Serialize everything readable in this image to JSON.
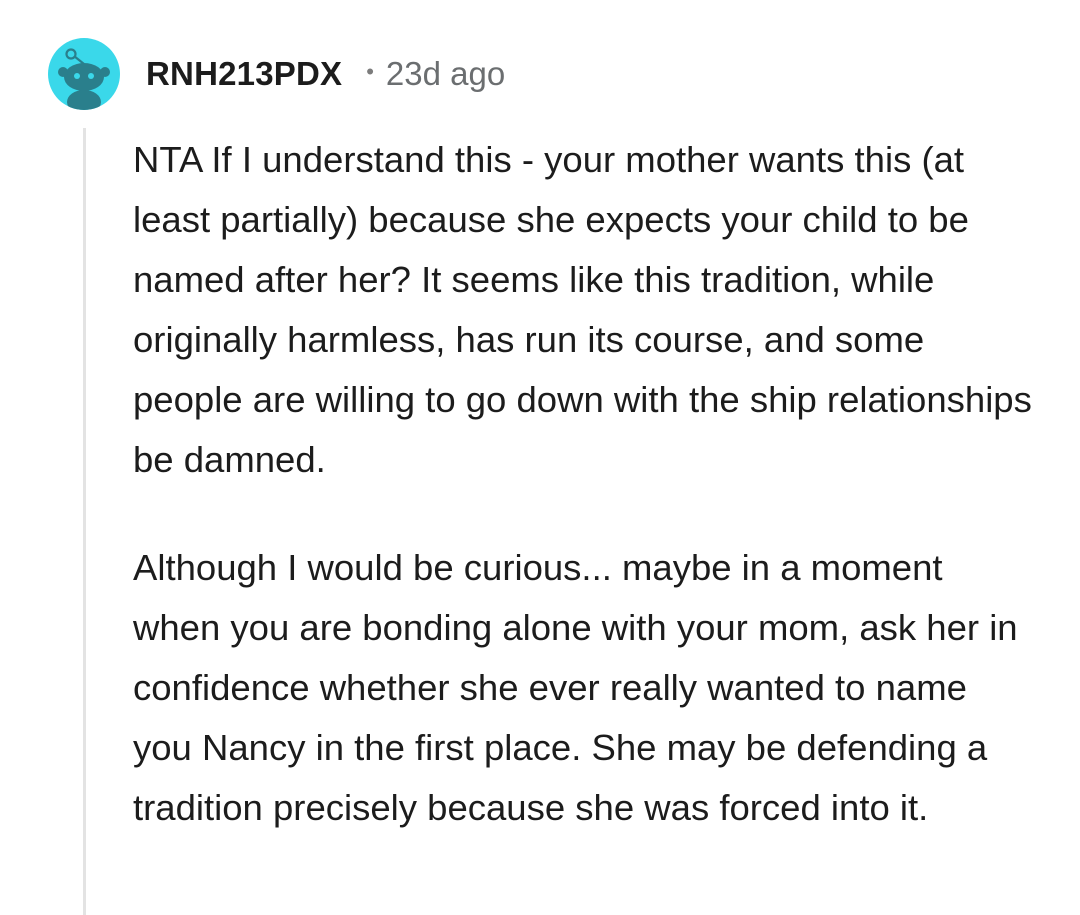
{
  "comment": {
    "author": "RNH213PDX",
    "separator": "•",
    "time": "23d ago",
    "avatar_icon": "reddit-snoo-avatar-icon",
    "avatar_color": "#3ad8ea",
    "paragraphs": [
      "NTA If I understand this - your mother wants this (at least partially) because she expects your child to be named after her? It seems like this tradition, while originally harmless, has run its course, and some people are willing to go down with the ship relationships be damned.",
      "Although I would be curious... maybe in a moment when you are bonding alone with your mom, ask her in confidence whether she ever really wanted to name you Nancy in the first place. She may be defending a tradition precisely because she was forced into it."
    ]
  }
}
